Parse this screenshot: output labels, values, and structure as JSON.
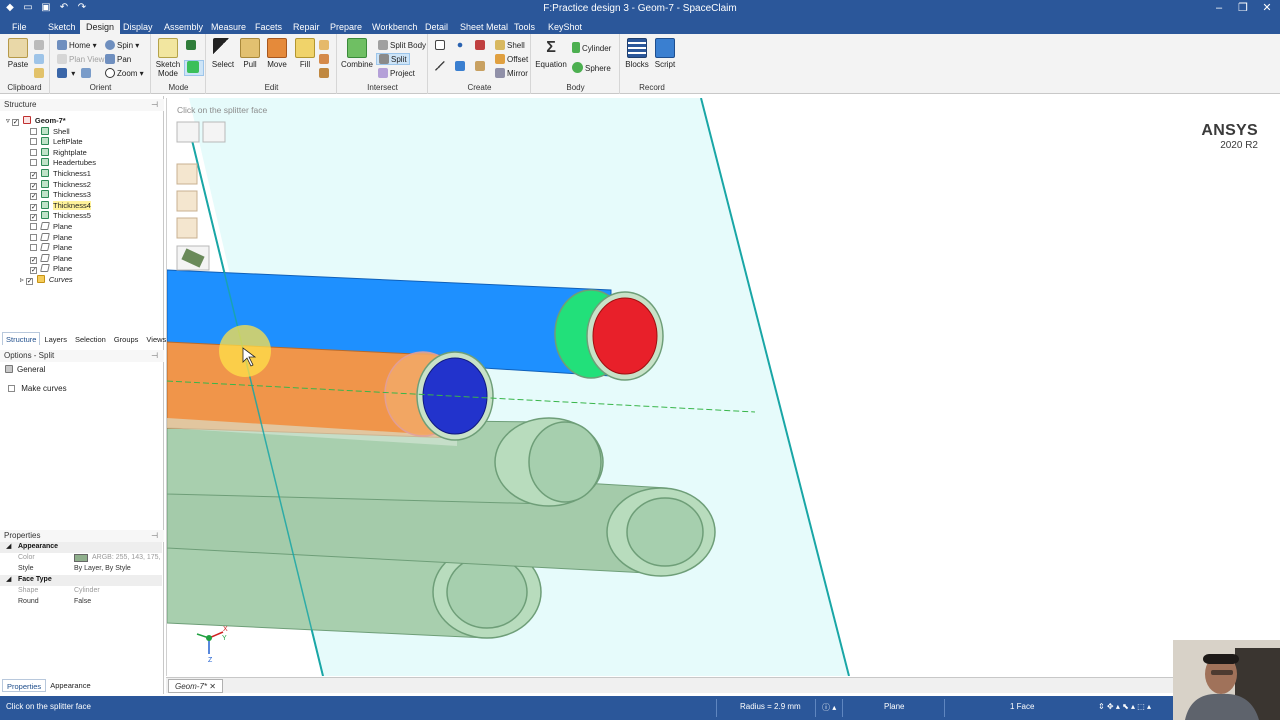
{
  "window": {
    "title": "F:Practice design 3 - Geom-7 - SpaceClaim"
  },
  "menu": {
    "tabs": [
      "File",
      "Sketch",
      "Design",
      "Display",
      "Assembly",
      "Measure",
      "Facets",
      "Repair",
      "Prepare",
      "Workbench",
      "Detail",
      "Sheet Metal",
      "Tools",
      "KeyShot"
    ],
    "active": "Design"
  },
  "ribbon": {
    "clipboard": {
      "label": "Clipboard",
      "paste": "Paste"
    },
    "orient": {
      "label": "Orient",
      "home": "Home",
      "spin": "Spin",
      "plan_view": "Plan View",
      "pan": "Pan",
      "zoom": "Zoom"
    },
    "mode": {
      "label": "Mode",
      "sketch_mode": "Sketch Mode"
    },
    "edit": {
      "label": "Edit",
      "select": "Select",
      "pull": "Pull",
      "move": "Move",
      "fill": "Fill"
    },
    "intersect": {
      "label": "Intersect",
      "combine": "Combine",
      "split_body": "Split Body",
      "split": "Split",
      "project": "Project"
    },
    "create": {
      "label": "Create",
      "shell": "Shell",
      "offset": "Offset",
      "mirror": "Mirror"
    },
    "body": {
      "label": "Body",
      "equation": "Equation",
      "cylinder": "Cylinder",
      "sphere": "Sphere"
    },
    "record": {
      "label": "Record",
      "blocks": "Blocks",
      "script": "Script"
    }
  },
  "structure": {
    "header": "Structure",
    "items": [
      {
        "label": "Geom-7*",
        "checked": true,
        "kind": "root",
        "bold": true
      },
      {
        "label": "Shell",
        "checked": false,
        "kind": "body"
      },
      {
        "label": "LeftPlate",
        "checked": false,
        "kind": "body"
      },
      {
        "label": "Rightplate",
        "checked": false,
        "kind": "body"
      },
      {
        "label": "Headertubes",
        "checked": false,
        "kind": "body"
      },
      {
        "label": "Thickness1",
        "checked": true,
        "kind": "body"
      },
      {
        "label": "Thickness2",
        "checked": true,
        "kind": "body"
      },
      {
        "label": "Thickness3",
        "checked": true,
        "kind": "body"
      },
      {
        "label": "Thickness4",
        "checked": true,
        "kind": "body",
        "highlight": true
      },
      {
        "label": "Thickness5",
        "checked": true,
        "kind": "body"
      },
      {
        "label": "Plane",
        "checked": false,
        "kind": "plane"
      },
      {
        "label": "Plane",
        "checked": false,
        "kind": "plane"
      },
      {
        "label": "Plane",
        "checked": false,
        "kind": "plane"
      },
      {
        "label": "Plane",
        "checked": true,
        "kind": "plane"
      },
      {
        "label": "Plane",
        "checked": true,
        "kind": "plane"
      },
      {
        "label": "Curves",
        "checked": true,
        "kind": "folder",
        "italic": true
      }
    ]
  },
  "panel_tabs": [
    "Structure",
    "Layers",
    "Selection",
    "Groups",
    "Views"
  ],
  "options": {
    "header": "Options - Split",
    "general": "General",
    "make_curves": "Make curves"
  },
  "properties": {
    "header": "Properties",
    "rows": [
      {
        "type": "cat",
        "key": "Appearance"
      },
      {
        "key": "Color",
        "value": "ARGB: 255, 143, 175,",
        "disabled": true,
        "swatch": "#8faf8c"
      },
      {
        "key": "Style",
        "value": "By Layer, By Style"
      },
      {
        "type": "cat",
        "key": "Face Type"
      },
      {
        "key": "Shape",
        "value": "Cylinder",
        "disabled": true
      },
      {
        "key": "Round",
        "value": "False"
      }
    ]
  },
  "bottom_tabs": [
    "Properties",
    "Appearance"
  ],
  "document_tab": "Geom-7*",
  "viewport": {
    "hint": "Click on the splitter face",
    "logo_brand": "ANSYS",
    "logo_version": "2020 R2",
    "triad": {
      "x": "X",
      "y": "Y",
      "z": "Z"
    }
  },
  "status": {
    "message": "Click on the splitter face",
    "radius": "Radius = 2.9 mm",
    "selection_filter": "Plane",
    "selection_count": "1 Face"
  },
  "colors": {
    "accent": "#2b579a",
    "tube_green": "#a8cfae",
    "tube_blue": "#1e90ff",
    "tube_orange": "#f0954a",
    "face_red": "#e8202a",
    "face_blue": "#2233cc",
    "face_green": "#22e07a",
    "plane_fill": "#e6fbfb",
    "plane_edge": "#19a6a6"
  }
}
